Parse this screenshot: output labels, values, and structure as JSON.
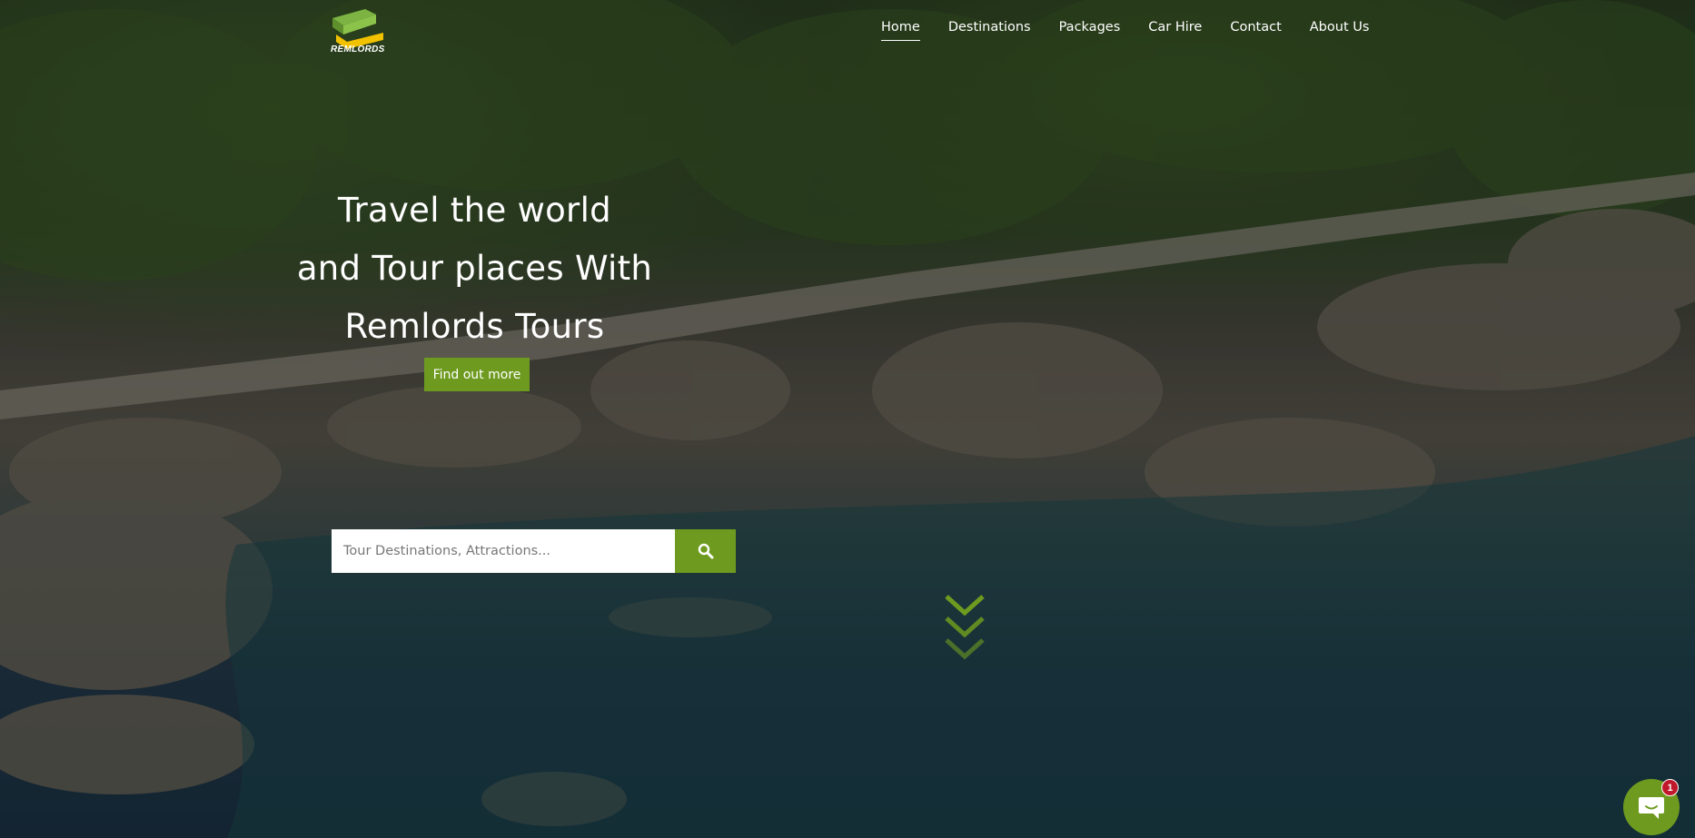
{
  "brand": {
    "name": "REMLORDS",
    "colors": {
      "logo_green": "#7cb342",
      "logo_yellow": "#f2c200",
      "accent": "#6e9b1f"
    }
  },
  "nav": {
    "items": [
      {
        "label": "Home",
        "active": true
      },
      {
        "label": "Destinations",
        "active": false
      },
      {
        "label": "Packages",
        "active": false
      },
      {
        "label": "Car Hire",
        "active": false
      },
      {
        "label": "Contact",
        "active": false
      },
      {
        "label": "About Us",
        "active": false
      }
    ]
  },
  "hero": {
    "lines": [
      "Travel the world",
      "and Tour places With",
      "Remlords Tours"
    ],
    "cta_label": "Find out more"
  },
  "search": {
    "placeholder": "Tour Destinations, Attractions...",
    "value": "",
    "button_icon": "search-icon"
  },
  "scroll_indicator": {
    "icon": "chevrons-down-icon"
  },
  "chat": {
    "icon": "chat-bubble-icon",
    "badge_count": "1"
  }
}
